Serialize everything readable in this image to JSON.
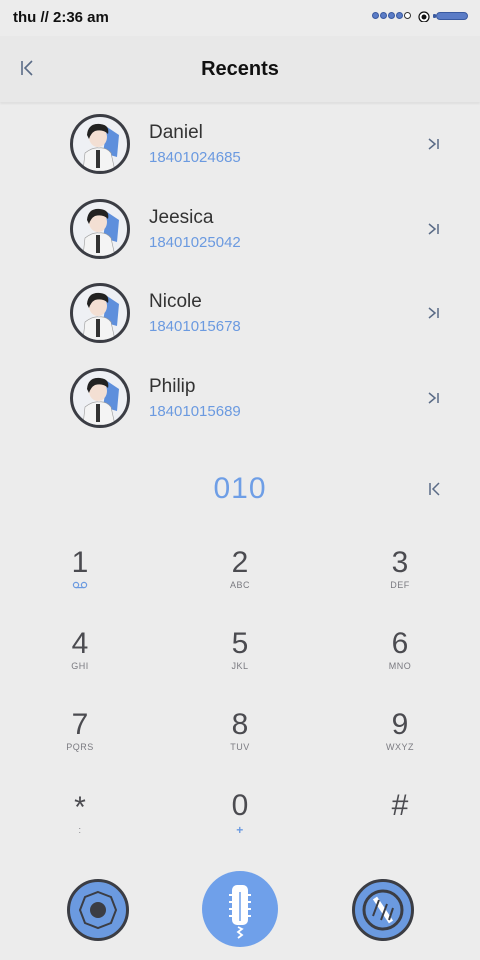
{
  "status_bar": {
    "time": "thu // 2:36 am"
  },
  "header": {
    "title": "Recents"
  },
  "contacts": [
    {
      "name": "Daniel",
      "number": "18401024685"
    },
    {
      "name": "Jeesica",
      "number": "18401025042"
    },
    {
      "name": "Nicole",
      "number": "18401015678"
    },
    {
      "name": "Philip",
      "number": "18401015689"
    }
  ],
  "dialer": {
    "input": "010",
    "keys": [
      {
        "digit": "1",
        "letters": ""
      },
      {
        "digit": "2",
        "letters": "ABC"
      },
      {
        "digit": "3",
        "letters": "DEF"
      },
      {
        "digit": "4",
        "letters": "GHI"
      },
      {
        "digit": "5",
        "letters": "JKL"
      },
      {
        "digit": "6",
        "letters": "MNO"
      },
      {
        "digit": "7",
        "letters": "PQRS"
      },
      {
        "digit": "8",
        "letters": "TUV"
      },
      {
        "digit": "9",
        "letters": "WXYZ"
      },
      {
        "digit": "*",
        "letters": ":"
      },
      {
        "digit": "0",
        "letters": "+"
      },
      {
        "digit": "#",
        "letters": ""
      }
    ]
  },
  "colors": {
    "accent": "#6b9ae0",
    "background": "#ececec",
    "dark": "#3b3d44"
  },
  "icons": {
    "back": "back-arrow-icon",
    "call": "call-arrow-icon",
    "delete": "backspace-icon",
    "voicemail": "voicemail-icon",
    "left_button": "camera-shutter-icon",
    "center_button": "microphone-icon",
    "right_button": "no-pen-icon"
  }
}
